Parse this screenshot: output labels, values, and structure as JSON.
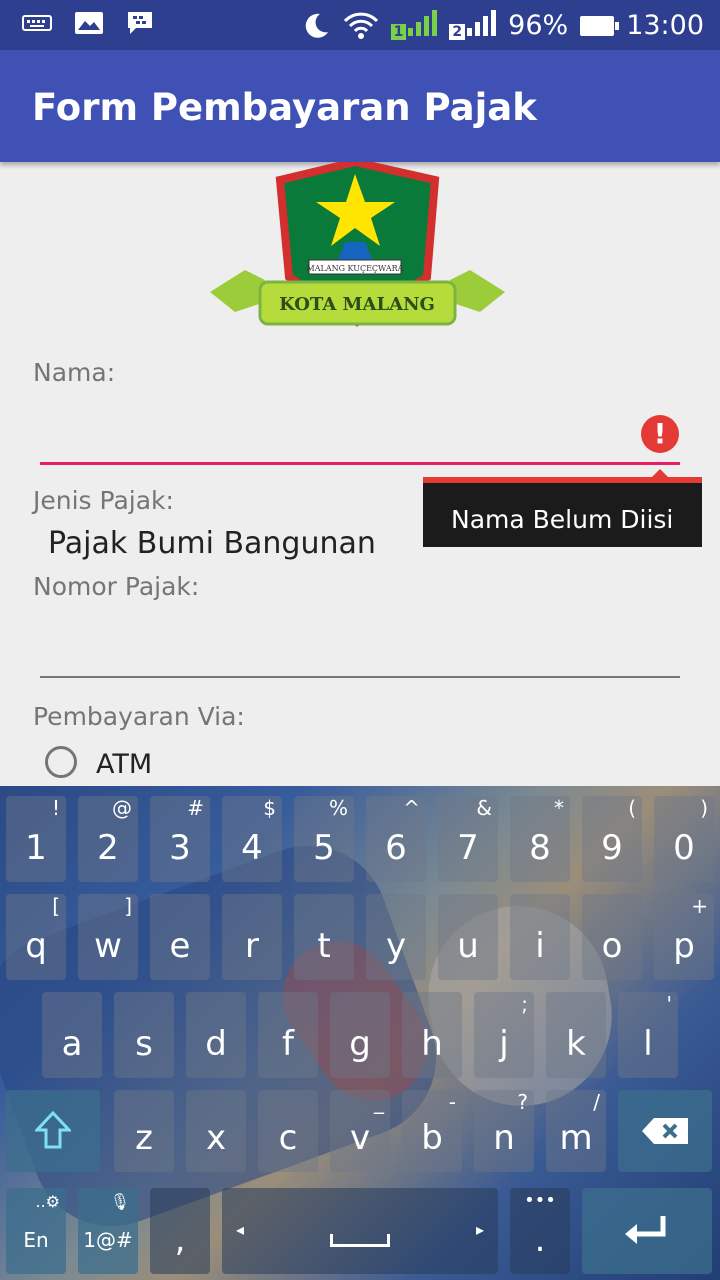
{
  "status_bar": {
    "sim1_badge": "1",
    "sim2_badge": "2",
    "battery": "96%",
    "time": "13:00"
  },
  "app_bar": {
    "title": "Form Pembayaran Pajak"
  },
  "logo": {
    "banner_text": "KOTA MALANG",
    "motto_text": "MALANG KUÇEÇWARA"
  },
  "form": {
    "nama_label": "Nama:",
    "nama_value": "",
    "nama_error": "Nama Belum Diisi",
    "jenis_label": "Jenis Pajak:",
    "jenis_value": "Pajak Bumi Bangunan",
    "nomor_label": "Nomor Pajak:",
    "nomor_value": "",
    "via_label": "Pembayaran Via:",
    "via_options": [
      "ATM"
    ]
  },
  "keyboard": {
    "row1": [
      {
        "k": "1",
        "s": "!"
      },
      {
        "k": "2",
        "s": "@"
      },
      {
        "k": "3",
        "s": "#"
      },
      {
        "k": "4",
        "s": "$"
      },
      {
        "k": "5",
        "s": "%"
      },
      {
        "k": "6",
        "s": "^"
      },
      {
        "k": "7",
        "s": "&"
      },
      {
        "k": "8",
        "s": "*"
      },
      {
        "k": "9",
        "s": "("
      },
      {
        "k": "0",
        "s": ")"
      }
    ],
    "row2": [
      {
        "k": "q",
        "s": "["
      },
      {
        "k": "w",
        "s": "]"
      },
      {
        "k": "e",
        "s": ""
      },
      {
        "k": "r",
        "s": ""
      },
      {
        "k": "t",
        "s": ""
      },
      {
        "k": "y",
        "s": ""
      },
      {
        "k": "u",
        "s": ""
      },
      {
        "k": "i",
        "s": ""
      },
      {
        "k": "o",
        "s": ""
      },
      {
        "k": "p",
        "s": "+"
      }
    ],
    "row3": [
      {
        "k": "a",
        "s": ""
      },
      {
        "k": "s",
        "s": ""
      },
      {
        "k": "d",
        "s": ""
      },
      {
        "k": "f",
        "s": ""
      },
      {
        "k": "g",
        "s": ""
      },
      {
        "k": "h",
        "s": ""
      },
      {
        "k": "j",
        "s": ";"
      },
      {
        "k": "k",
        "s": ""
      },
      {
        "k": "l",
        "s": "'"
      }
    ],
    "row4": [
      {
        "k": "z",
        "s": ""
      },
      {
        "k": "x",
        "s": ""
      },
      {
        "k": "c",
        "s": ""
      },
      {
        "k": "v",
        "s": "_"
      },
      {
        "k": "b",
        "s": "-"
      },
      {
        "k": "n",
        "s": "?"
      },
      {
        "k": "m",
        "s": "/"
      }
    ],
    "lang_key": "En",
    "symbols_key": "1@#",
    "comma_key": ",",
    "period_key": "."
  },
  "colors": {
    "primary": "#3f51b5",
    "primary_dark": "#2f3f8f",
    "error": "#e53935",
    "accent_line": "#e91e63"
  }
}
